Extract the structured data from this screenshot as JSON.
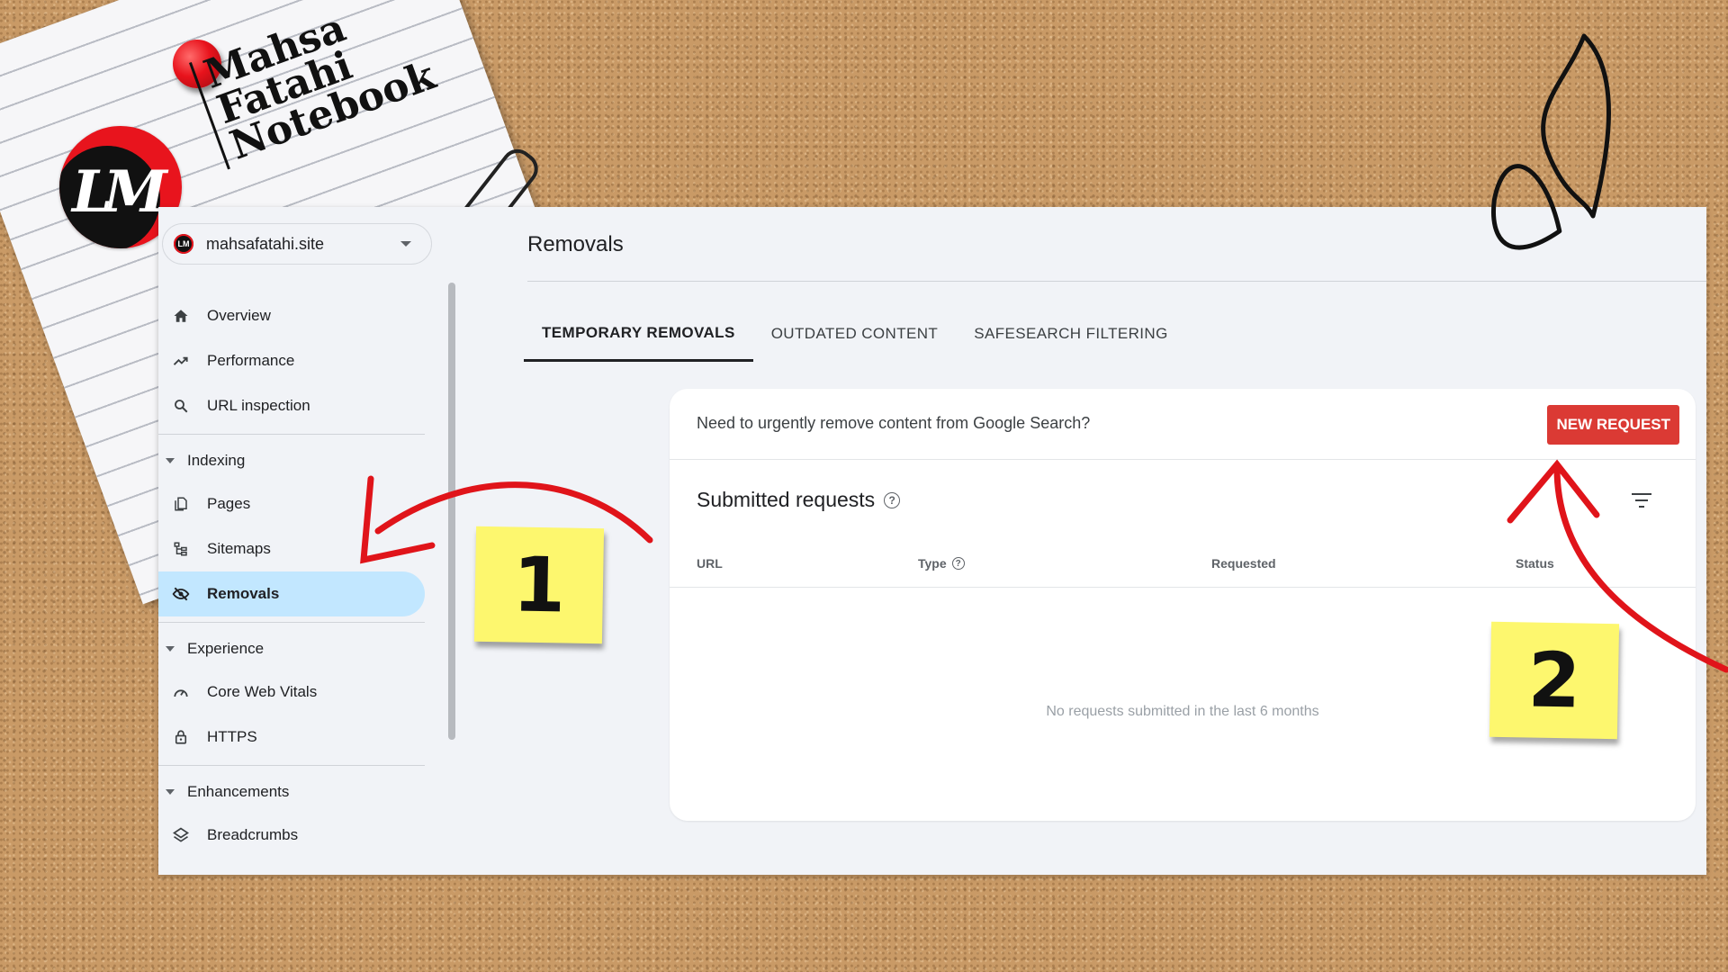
{
  "brand": {
    "monogram": "LM",
    "line1": "Mahsa",
    "line2": "Fatahi",
    "line3": "Notebook"
  },
  "property": {
    "avatar_text": "LM",
    "name": "mahsafatahi.site"
  },
  "nav": {
    "overview": "Overview",
    "performance": "Performance",
    "url_inspection": "URL inspection",
    "indexing": "Indexing",
    "pages": "Pages",
    "sitemaps": "Sitemaps",
    "removals": "Removals",
    "experience": "Experience",
    "core_web_vitals": "Core Web Vitals",
    "https": "HTTPS",
    "enhancements": "Enhancements",
    "breadcrumbs": "Breadcrumbs"
  },
  "page": {
    "title": "Removals"
  },
  "tabs": [
    {
      "label": "TEMPORARY REMOVALS",
      "active": true
    },
    {
      "label": "OUTDATED CONTENT",
      "active": false
    },
    {
      "label": "SAFESEARCH FILTERING",
      "active": false
    }
  ],
  "card": {
    "urgent_text": "Need to urgently remove content from Google Search?",
    "new_request": "NEW REQUEST",
    "submitted_title": "Submitted requests",
    "columns": {
      "url": "URL",
      "type": "Type",
      "requested": "Requested",
      "status": "Status"
    },
    "empty": "No requests submitted in the last 6 months"
  },
  "annotations": {
    "note1": "1",
    "note2": "2",
    "arrow_color": "#e0141a",
    "note_color": "#fdf76e"
  },
  "accent": {
    "active_nav_bg": "#c2e7ff",
    "button_bg": "#db3a34"
  }
}
